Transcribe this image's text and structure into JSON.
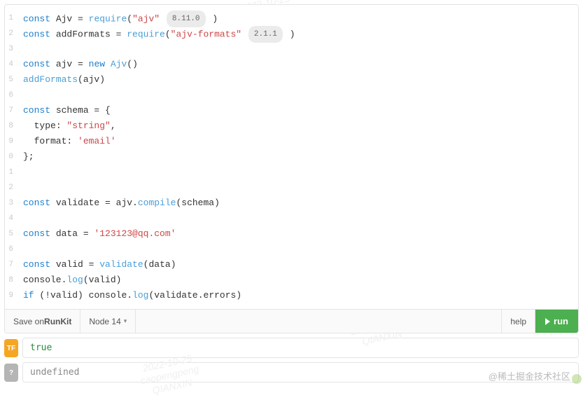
{
  "watermarks": [
    {
      "date": "2022-10-25",
      "user": "caopengpeng",
      "org": "QIANXIN"
    }
  ],
  "code": {
    "lines": [
      [
        {
          "t": "const ",
          "c": "kw"
        },
        {
          "t": "Ajv ",
          "c": "ident"
        },
        {
          "t": "= ",
          "c": "dot"
        },
        {
          "t": "require",
          "c": "fn"
        },
        {
          "t": "(",
          "c": "paren"
        },
        {
          "t": "\"ajv\"",
          "c": "str"
        },
        {
          "badge": "8.11.0"
        },
        {
          "t": ")",
          "c": "paren"
        }
      ],
      [
        {
          "t": "const ",
          "c": "kw"
        },
        {
          "t": "addFormats ",
          "c": "ident"
        },
        {
          "t": "= ",
          "c": "dot"
        },
        {
          "t": "require",
          "c": "fn"
        },
        {
          "t": "(",
          "c": "paren"
        },
        {
          "t": "\"ajv-formats\"",
          "c": "str"
        },
        {
          "badge": "2.1.1"
        },
        {
          "t": ")",
          "c": "paren"
        }
      ],
      [],
      [
        {
          "t": "const ",
          "c": "kw"
        },
        {
          "t": "ajv ",
          "c": "ident"
        },
        {
          "t": "= ",
          "c": "dot"
        },
        {
          "t": "new ",
          "c": "kw"
        },
        {
          "t": "Ajv",
          "c": "fn"
        },
        {
          "t": "()",
          "c": "paren"
        }
      ],
      [
        {
          "t": "addFormats",
          "c": "fn"
        },
        {
          "t": "(",
          "c": "paren"
        },
        {
          "t": "ajv",
          "c": "ident"
        },
        {
          "t": ")",
          "c": "paren"
        }
      ],
      [],
      [
        {
          "t": "const ",
          "c": "kw"
        },
        {
          "t": "schema ",
          "c": "ident"
        },
        {
          "t": "= {",
          "c": "dot"
        }
      ],
      [
        {
          "t": "  type",
          "c": "ident"
        },
        {
          "t": ": ",
          "c": "dot"
        },
        {
          "t": "\"string\"",
          "c": "str"
        },
        {
          "t": ",",
          "c": "dot"
        }
      ],
      [
        {
          "t": "  format",
          "c": "ident"
        },
        {
          "t": ": ",
          "c": "dot"
        },
        {
          "t": "'email'",
          "c": "str2"
        }
      ],
      [
        {
          "t": "};",
          "c": "dot"
        }
      ],
      [],
      [],
      [
        {
          "t": "const ",
          "c": "kw"
        },
        {
          "t": "validate ",
          "c": "ident"
        },
        {
          "t": "= ",
          "c": "dot"
        },
        {
          "t": "ajv",
          "c": "ident"
        },
        {
          "t": ".",
          "c": "dot"
        },
        {
          "t": "compile",
          "c": "fn"
        },
        {
          "t": "(",
          "c": "paren"
        },
        {
          "t": "schema",
          "c": "ident"
        },
        {
          "t": ")",
          "c": "paren"
        }
      ],
      [],
      [
        {
          "t": "const ",
          "c": "kw"
        },
        {
          "t": "data ",
          "c": "ident"
        },
        {
          "t": "= ",
          "c": "dot"
        },
        {
          "t": "'123123@qq.com'",
          "c": "str2"
        }
      ],
      [],
      [
        {
          "t": "const ",
          "c": "kw"
        },
        {
          "t": "valid ",
          "c": "ident"
        },
        {
          "t": "= ",
          "c": "dot"
        },
        {
          "t": "validate",
          "c": "fn"
        },
        {
          "t": "(",
          "c": "paren"
        },
        {
          "t": "data",
          "c": "ident"
        },
        {
          "t": ")",
          "c": "paren"
        }
      ],
      [
        {
          "t": "console",
          "c": "ident"
        },
        {
          "t": ".",
          "c": "dot"
        },
        {
          "t": "log",
          "c": "fn"
        },
        {
          "t": "(",
          "c": "paren"
        },
        {
          "t": "valid",
          "c": "ident"
        },
        {
          "t": ")",
          "c": "paren"
        }
      ],
      [
        {
          "t": "if ",
          "c": "kw"
        },
        {
          "t": "(!",
          "c": "paren"
        },
        {
          "t": "valid",
          "c": "ident"
        },
        {
          "t": ") ",
          "c": "paren"
        },
        {
          "t": "console",
          "c": "ident"
        },
        {
          "t": ".",
          "c": "dot"
        },
        {
          "t": "log",
          "c": "fn"
        },
        {
          "t": "(",
          "c": "paren"
        },
        {
          "t": "validate",
          "c": "ident"
        },
        {
          "t": ".",
          "c": "dot"
        },
        {
          "t": "errors",
          "c": "ident"
        },
        {
          "t": ")",
          "c": "paren"
        }
      ]
    ]
  },
  "toolbar": {
    "save_label": "Save on ",
    "save_brand": "RunKit",
    "node_label": "Node 14",
    "help_label": "help",
    "run_label": "run"
  },
  "output": {
    "tf_badge": "TF",
    "q_badge": "?",
    "line1": "true",
    "line2": "undefined"
  },
  "footer": "@稀土掘金技术社区"
}
